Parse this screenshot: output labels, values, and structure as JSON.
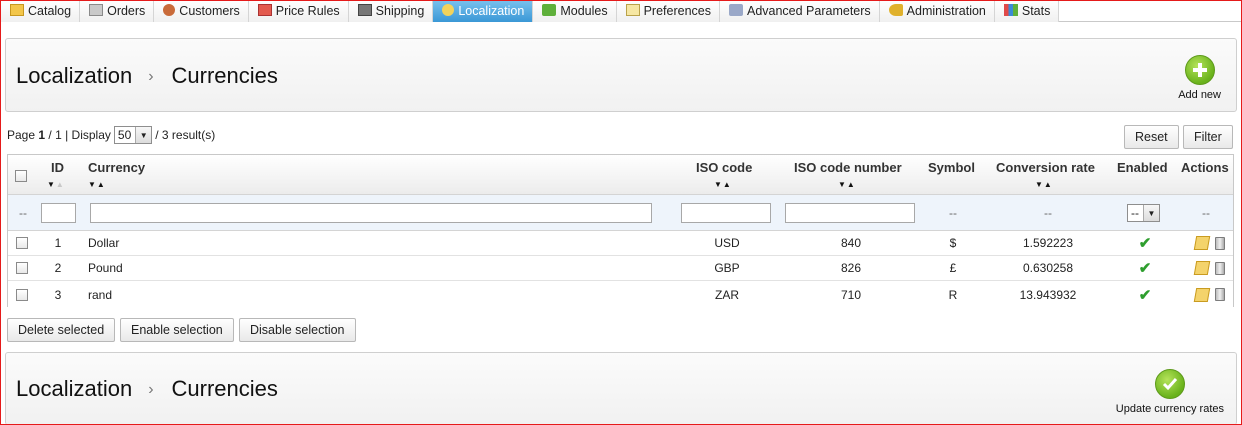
{
  "nav": {
    "tabs": [
      {
        "label": "Catalog",
        "icon": "folder-icon",
        "active": false
      },
      {
        "label": "Orders",
        "icon": "cart-icon",
        "active": false
      },
      {
        "label": "Customers",
        "icon": "customer-icon",
        "active": false
      },
      {
        "label": "Price Rules",
        "icon": "price-tag-icon",
        "active": false
      },
      {
        "label": "Shipping",
        "icon": "truck-icon",
        "active": false
      },
      {
        "label": "Localization",
        "icon": "globe-icon",
        "active": true
      },
      {
        "label": "Modules",
        "icon": "puzzle-icon",
        "active": false
      },
      {
        "label": "Preferences",
        "icon": "preferences-icon",
        "active": false
      },
      {
        "label": "Advanced Parameters",
        "icon": "wrench-icon",
        "active": false
      },
      {
        "label": "Administration",
        "icon": "key-icon",
        "active": false
      },
      {
        "label": "Stats",
        "icon": "bar-chart-icon",
        "active": false
      }
    ]
  },
  "header": {
    "section": "Localization",
    "page": "Currencies",
    "separator": "›",
    "add_new_label": "Add new"
  },
  "pagination": {
    "page_word": "Page",
    "current_page": "1",
    "of_pages": "/ 1 | Display",
    "per_page": "50",
    "results": "/ 3 result(s)"
  },
  "filter_buttons": {
    "reset": "Reset",
    "filter": "Filter"
  },
  "table": {
    "columns": {
      "id": "ID",
      "currency": "Currency",
      "iso_code": "ISO code",
      "iso_code_number": "ISO code number",
      "symbol": "Symbol",
      "conversion_rate": "Conversion rate",
      "enabled": "Enabled",
      "actions": "Actions"
    },
    "filter_row": {
      "dash": "--",
      "enabled_select": "--"
    },
    "rows": [
      {
        "id": "1",
        "currency": "Dollar",
        "iso_code": "USD",
        "iso_code_number": "840",
        "symbol": "$",
        "conversion_rate": "1.592223",
        "enabled": "✔"
      },
      {
        "id": "2",
        "currency": "Pound",
        "iso_code": "GBP",
        "iso_code_number": "826",
        "symbol": "£",
        "conversion_rate": "0.630258",
        "enabled": "✔"
      },
      {
        "id": "3",
        "currency": "rand",
        "iso_code": "ZAR",
        "iso_code_number": "710",
        "symbol": "R",
        "conversion_rate": "13.943932",
        "enabled": "✔"
      }
    ]
  },
  "bulk_actions": {
    "delete": "Delete selected",
    "enable": "Enable selection",
    "disable": "Disable selection"
  },
  "footer_header": {
    "section": "Localization",
    "page": "Currencies",
    "separator": "›",
    "update_label": "Update currency rates"
  },
  "colors": {
    "active_tab": "#3a98d6",
    "frame": "#e51a1a",
    "enabled_tick": "#2e9e2e",
    "action_button": "#69b21b"
  }
}
